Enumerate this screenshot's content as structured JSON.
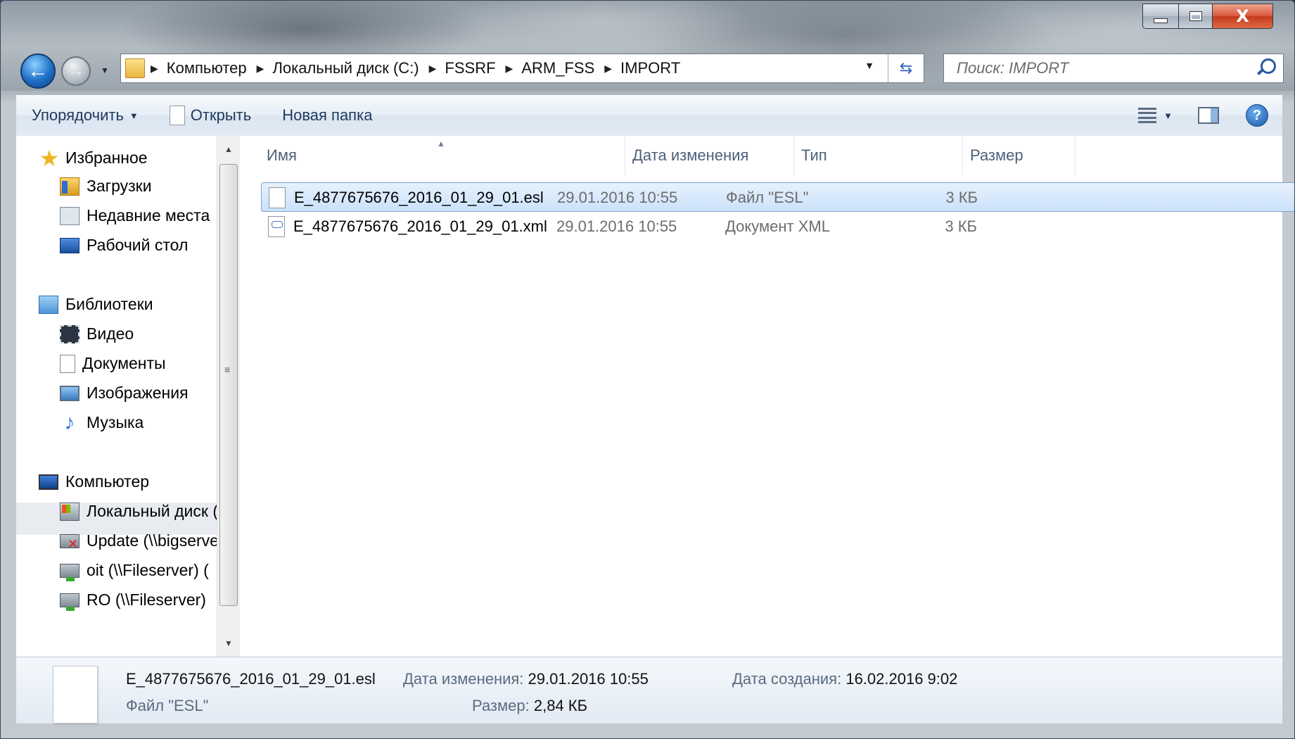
{
  "window": {
    "caption": {
      "close_glyph": "X"
    }
  },
  "address": {
    "breadcrumbs": [
      "Компьютер",
      "Локальный диск (C:)",
      "FSSRF",
      "ARM_FSS",
      "IMPORT"
    ]
  },
  "search": {
    "placeholder": "Поиск: IMPORT"
  },
  "toolbar": {
    "organize_label": "Упорядочить",
    "open_label": "Открыть",
    "new_folder_label": "Новая папка"
  },
  "nav": {
    "favorites": {
      "label": "Избранное",
      "items": [
        "Загрузки",
        "Недавние места",
        "Рабочий стол"
      ]
    },
    "libraries": {
      "label": "Библиотеки",
      "items": [
        "Видео",
        "Документы",
        "Изображения",
        "Музыка"
      ]
    },
    "computer": {
      "label": "Компьютер",
      "items": [
        "Локальный диск (C:)",
        "Update (\\\\bigserver)",
        "oit (\\\\Fileserver) (",
        "RO (\\\\Fileserver)"
      ]
    }
  },
  "columns": {
    "name": "Имя",
    "date": "Дата изменения",
    "type": "Тип",
    "size": "Размер"
  },
  "files": [
    {
      "name": "E_4877675676_2016_01_29_01.esl",
      "date": "29.01.2016 10:55",
      "type": "Файл \"ESL\"",
      "size": "3 КБ",
      "selected": true
    },
    {
      "name": "E_4877675676_2016_01_29_01.xml",
      "date": "29.01.2016 10:55",
      "type": "Документ XML",
      "size": "3 КБ",
      "selected": false
    }
  ],
  "details": {
    "filename": "E_4877675676_2016_01_29_01.esl",
    "filetype": "Файл \"ESL\"",
    "modified_label": "Дата изменения:",
    "modified_value": "29.01.2016 10:55",
    "created_label": "Дата создания:",
    "created_value": "16.02.2016 9:02",
    "size_label": "Размер:",
    "size_value": "2,84 КБ"
  },
  "colors": {
    "accent": "#1f6fc6",
    "selection_bg": "#cbe2fa",
    "selection_border": "#7da2ce"
  }
}
